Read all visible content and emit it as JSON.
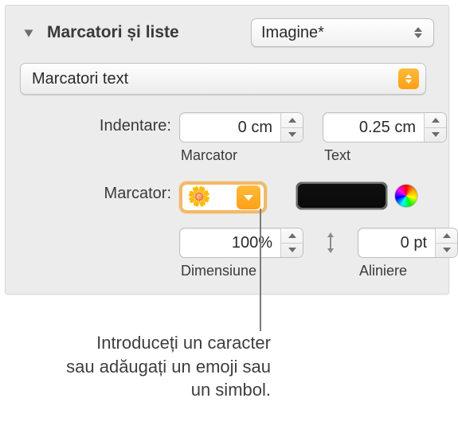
{
  "header": {
    "title": "Marcatori și liste",
    "style_popup": "Imagine*"
  },
  "bullet_type_popup": "Marcatori text",
  "indent": {
    "label": "Indentare:",
    "marker": {
      "value": "0 cm",
      "sublabel": "Marcator"
    },
    "text": {
      "value": "0.25 cm",
      "sublabel": "Text"
    }
  },
  "bullet": {
    "label": "Marcator:",
    "character": "🌼",
    "color": "#000000"
  },
  "size": {
    "value": "100%",
    "sublabel": "Dimensiune"
  },
  "align": {
    "value": "0 pt",
    "sublabel": "Aliniere"
  },
  "callout": "Introduceți un caracter sau adăugați un emoji sau un simbol."
}
